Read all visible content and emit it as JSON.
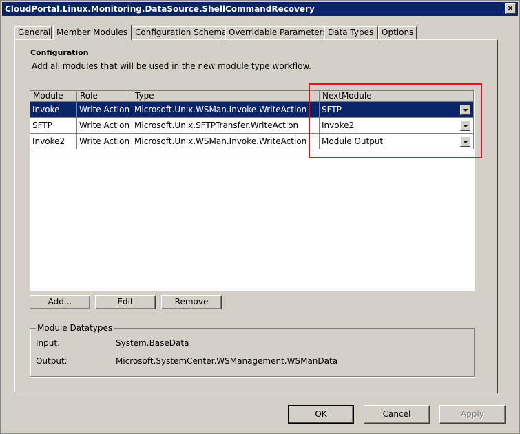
{
  "window": {
    "title": "CloudPortal.Linux.Monitoring.DataSource.ShellCommandRecovery",
    "close_glyph": "×"
  },
  "tabs": [
    {
      "label": "General"
    },
    {
      "label": "Member Modules"
    },
    {
      "label": "Configuration Schema"
    },
    {
      "label": "Overridable Parameters"
    },
    {
      "label": "Data Types"
    },
    {
      "label": "Options"
    }
  ],
  "configuration": {
    "title": "Configuration",
    "description": "Add all modules that will be used in the new module type workflow."
  },
  "grid": {
    "columns": [
      "Module",
      "Role",
      "Type",
      "NextModule"
    ],
    "rows": [
      {
        "module": "Invoke",
        "role": "Write Action",
        "type": "Microsoft.Unix.WSMan.Invoke.WriteAction",
        "next": "SFTP"
      },
      {
        "module": "SFTP",
        "role": "Write Action",
        "type": "Microsoft.Unix.SFTPTransfer.WriteAction",
        "next": "Invoke2"
      },
      {
        "module": "Invoke2",
        "role": "Write Action",
        "type": "Microsoft.Unix.WSMan.Invoke.WriteAction",
        "next": "Module Output"
      }
    ]
  },
  "grid_buttons": {
    "add": "Add...",
    "edit": "Edit",
    "remove": "Remove"
  },
  "datatypes": {
    "title": "Module Datatypes",
    "input_label": "Input:",
    "input_value": "System.BaseData",
    "output_label": "Output:",
    "output_value": "Microsoft.SystemCenter.WSManagement.WSManData"
  },
  "dialog_buttons": {
    "ok": "OK",
    "cancel": "Cancel",
    "apply": "Apply"
  },
  "colors": {
    "highlight": "#e8101a",
    "selection": "#0a246a",
    "titlebar": "#0a246a"
  }
}
